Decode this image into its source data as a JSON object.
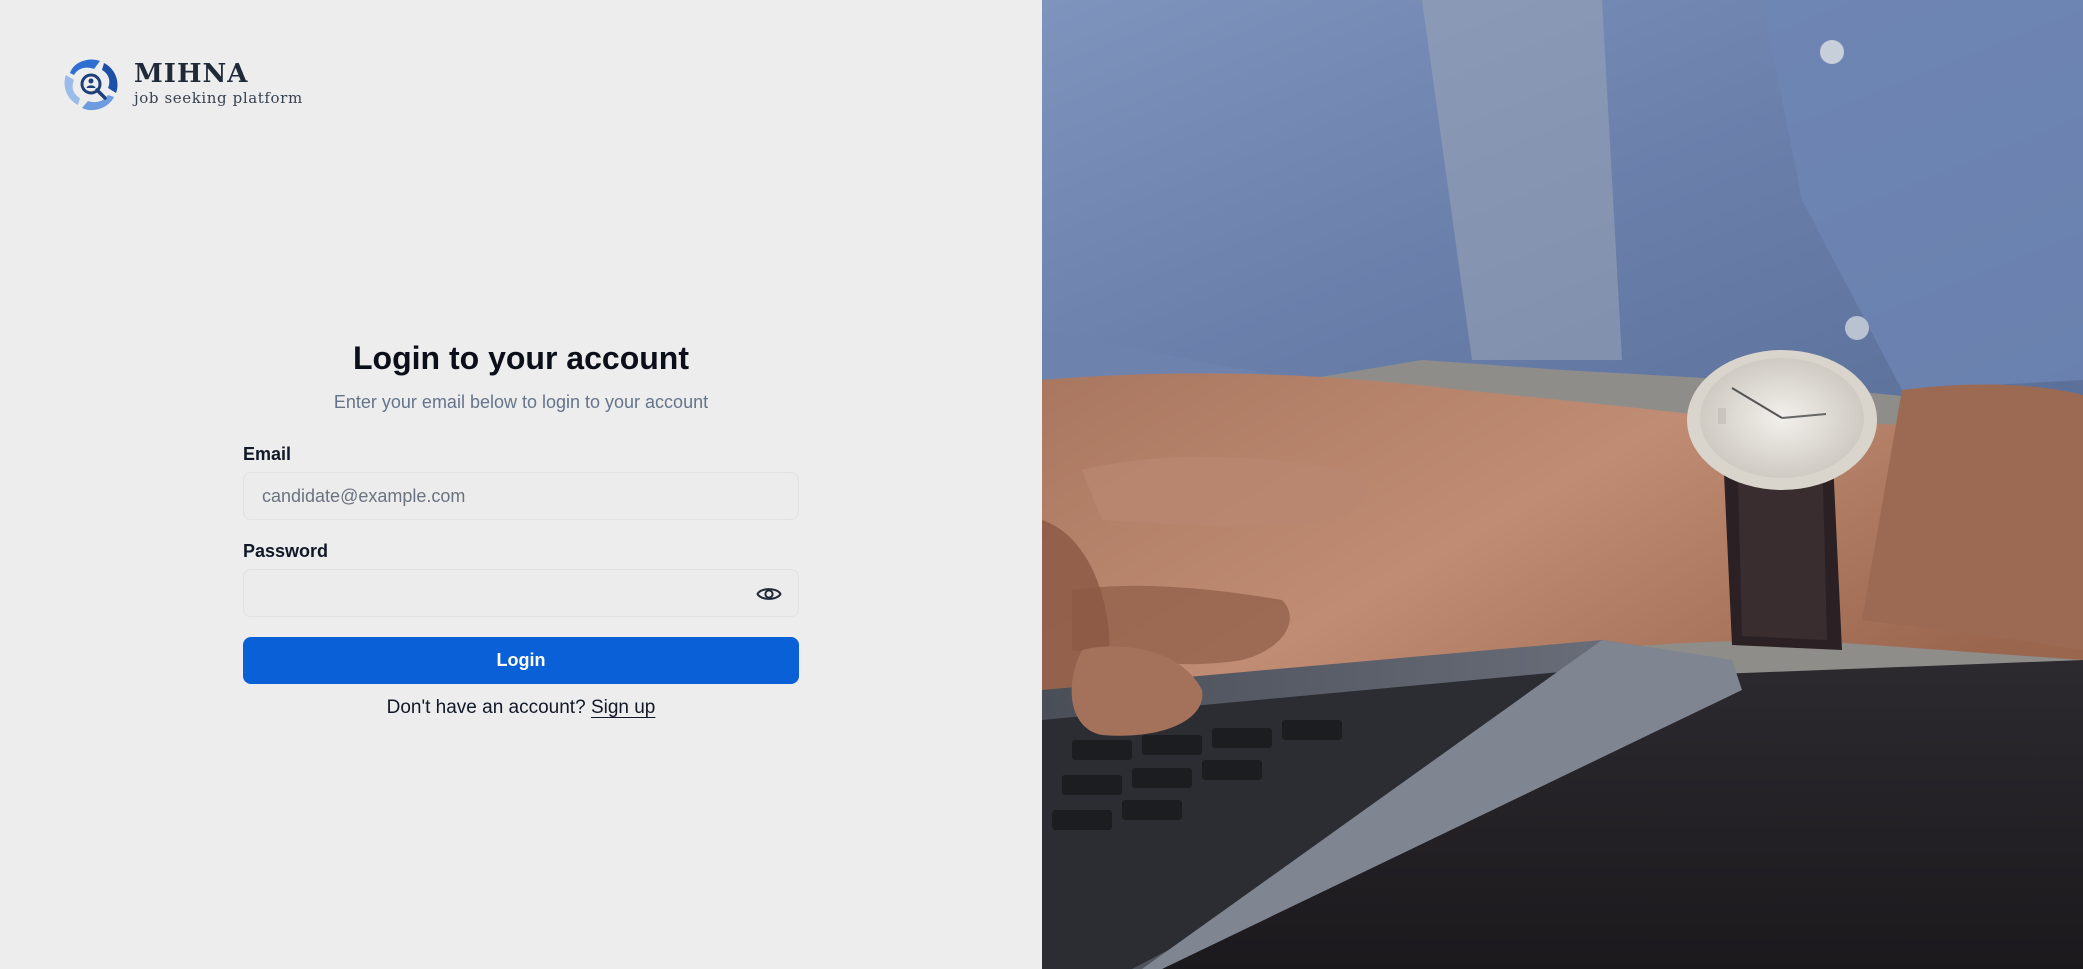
{
  "brand": {
    "name": "MIHNA",
    "tagline": "job seeking platform"
  },
  "login": {
    "title": "Login to your account",
    "subtitle": "Enter your email below to login to your account",
    "email_label": "Email",
    "email_placeholder": "candidate@example.com",
    "email_value": "",
    "password_label": "Password",
    "password_value": "",
    "login_button": "Login",
    "signup_prompt": "Don't have an account?",
    "signup_link": "Sign up"
  },
  "icons": {
    "logo": "mihna-logo-icon",
    "password_toggle": "eye-icon"
  },
  "colors": {
    "primary": "#0a60d6",
    "background": "#ededed",
    "muted_text": "#64748b"
  }
}
